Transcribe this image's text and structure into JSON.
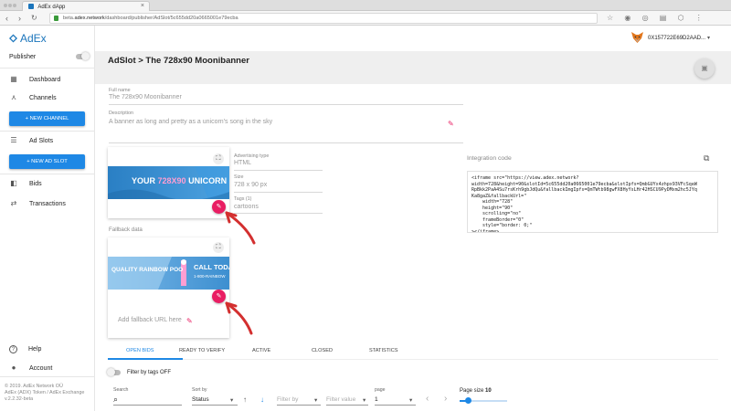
{
  "browser": {
    "tab_title": "AdEx dApp",
    "tab_close": "×",
    "url_prefix": "beta.",
    "url_domain": "adex.network",
    "url_path": "/dashboard/publisher/AdSlot/5c655dd20a0665001e79ecba",
    "nav_back": "‹",
    "nav_forward": "›",
    "nav_reload": "↻",
    "ext_icons": "☆ ◉ ◎ ▤ ⬡ ⋮"
  },
  "sidebar": {
    "logo_text": "AdEx",
    "mode_label": "Publisher",
    "items": [
      {
        "label": "Dashboard",
        "icon": "▦"
      },
      {
        "label": "Channels",
        "icon": "⋏"
      },
      {
        "label": "Ad Slots",
        "icon": "☰"
      },
      {
        "label": "Bids",
        "icon": "◧"
      },
      {
        "label": "Transactions",
        "icon": "⇄"
      }
    ],
    "new_channel_button": "+ NEW CHANNEL",
    "new_ad_slot_button": "+ NEW AD SLOT",
    "help_label": "Help",
    "help_icon": "?",
    "account_label": "Account",
    "account_icon": "●",
    "footer_lines": [
      "© 2019. AdEx Network OÜ",
      "AdEx (ADX) Token / AdEx Exchange",
      "v.2.2.32-beta"
    ]
  },
  "topbar": {
    "account_address": "0X157722E69D2AAD...",
    "caret": "▾"
  },
  "header": {
    "title": "AdSlot > The 728x90 Moonibanner",
    "save_icon": "▣"
  },
  "details": {
    "full_name_label": "Full name",
    "full_name_value": "The  728x90 Moonibanner",
    "description_label": "Description",
    "description_value": "A banner as long and pretty as a unicorn's song in the sky",
    "pencil_icon": "✎"
  },
  "ad_slot_card": {
    "banner_text_1": "YOUR",
    "banner_text_2": "728X90",
    "banner_text_3": "UNICORN HERE",
    "expand_icon": "⛶",
    "edit_icon": "✎"
  },
  "meta": {
    "type_label": "Advertising type",
    "type_value": "HTML",
    "size_label": "Size",
    "size_value": "728 x 90 px",
    "tags_label": "Tags (1)",
    "tags_value": "cartoons"
  },
  "fallback": {
    "section_label": "Fallback data",
    "banner_text_1": "QUALITY RAINBOW POO",
    "banner_text_2": "CALL TODAY",
    "banner_text_3": "1-800-RAINBOW",
    "add_url_placeholder": "Add fallback URL here",
    "expand_icon": "⛶",
    "edit_icon": "✎"
  },
  "integration": {
    "label": "Integration code",
    "copy_icon": "⧉",
    "code": "<iframe src=\"https://view.adex.network?\nwidth=728&height=90&slotId=5c655dd20a0665001e79ecba&slotIpfs=QmbGUYx4zhpx93VFcSqeW\nRpBkk2PaA4Su7rsKrh9gbJdQu&fallbackImgIpfs=QmTWtb98gwFX8HyYsLHr42HSCU9PyDMxm2hc5JYq\nKa8gaZ&fallbackUrl=\"\n    width=\"728\"\n    height=\"90\"\n    scrolling=\"no\"\n    frameBorder=\"0\"\n    style=\"border: 0;\"\n></iframe>"
  },
  "bid_tabs": [
    "OPEN BIDS",
    "READY TO VERIFY",
    "ACTIVE",
    "CLOSED",
    "STATISTICS"
  ],
  "filters": {
    "tags_filter_label": "Filter by tags OFF",
    "search_label": "Search",
    "search_icon": "⌕",
    "sort_label": "Sort by",
    "sort_value": "Status",
    "sort_asc_icon": "↑",
    "sort_desc_icon": "↓",
    "filter_by_placeholder": "Filter by",
    "filter_value_placeholder": "Filter value",
    "page_label": "page",
    "page_value": "1",
    "prev_icon": "‹",
    "next_icon": "›",
    "page_size_label": "Page size",
    "page_size_value": "10",
    "dropdown_icon": "▾"
  },
  "colors": {
    "brand_blue": "#1b75bc",
    "button_blue": "#1e88e5",
    "accent_pink": "#e91e63",
    "annotation_red": "#d32f2f"
  }
}
